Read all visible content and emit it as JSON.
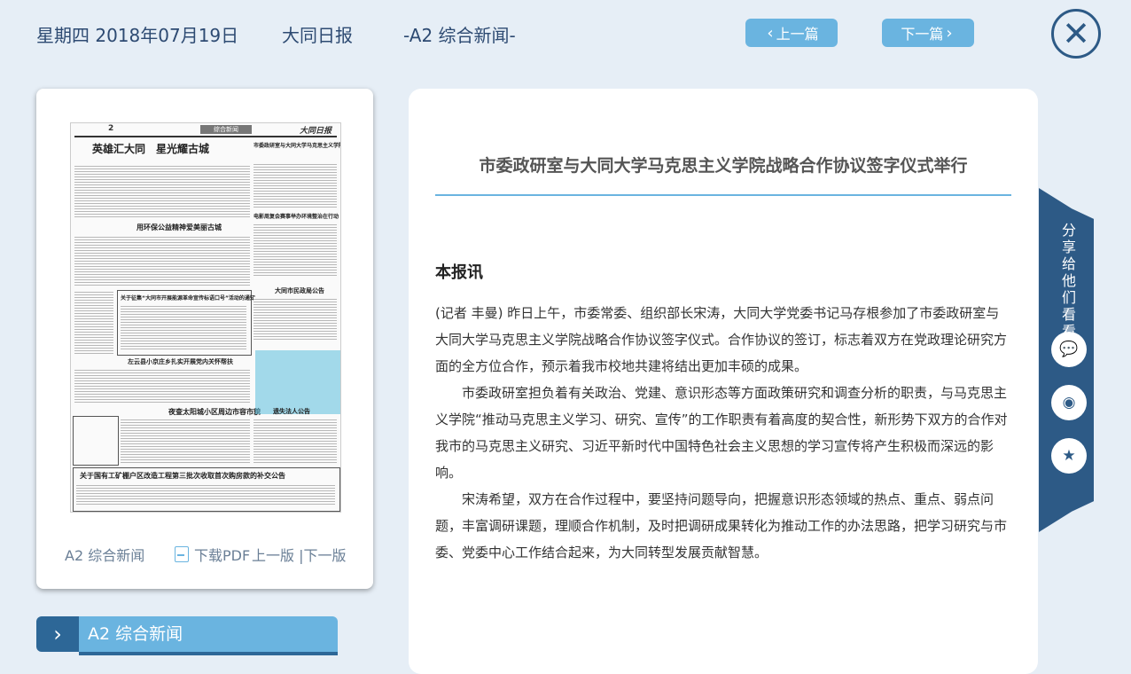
{
  "header": {
    "date": "星期四 2018年07月19日",
    "paper_name": "大同日报",
    "section": "-A2 综合新闻-",
    "prev_label": "上一篇",
    "next_label": "下一篇"
  },
  "thumbnail": {
    "page_no": "2",
    "band": "综合新闻",
    "masthead": "大同日报",
    "headlines": [
      "英雄汇大同　星光耀古城",
      "用环保公益精神爱美丽古城",
      "关于征集“大同市开展能源革命宣传标语口号”活动的通知",
      "左云县小京庄乡扎实开展党内关怀帮扶",
      "夜查太阳城小区周边市容市貌",
      "关于国有工矿棚户区改造工程第三批次收取首次购房款的补交公告",
      "市委政研室与大同大学马克思主义学院战略合作协议签字仪式举行",
      "电影周复会赛事举办环境整治在行动",
      "大同市民政局公告",
      "遗失法人公告"
    ],
    "caption": "A2 综合新闻",
    "pdf_label": "下载PDF",
    "prev_page": "上一版",
    "separator": " |",
    "next_page": "下一版"
  },
  "section_tab": {
    "arrow": "›",
    "label": "A2  综合新闻"
  },
  "article": {
    "title": "市委政研室与大同大学马克思主义学院战略合作协议签字仪式举行",
    "lead": "本报讯",
    "paragraphs": [
      "(记者 丰曼) 昨日上午，市委常委、组织部长宋涛，大同大学党委书记马存根参加了市委政研室与大同大学马克思主义学院战略合作协议签字仪式。合作协议的签订，标志着双方在党政理论研究方面的全方位合作，预示着我市校地共建将结出更加丰硕的成果。",
      "市委政研室担负着有关政治、党建、意识形态等方面政策研究和调查分析的职责，与马克思主义学院“推动马克思主义学习、研究、宣传”的工作职责有着高度的契合性，新形势下双方的合作对我市的马克思主义研究、习近平新时代中国特色社会主义思想的学习宣传将产生积极而深远的影响。",
      "宋涛希望，双方在合作过程中，要坚持问题导向，把握意识形态领域的热点、重点、弱点问题，丰富调研课题，理顺合作机制，及时把调研成果转化为推动工作的办法思路，把学习研究与市委、党委中心工作结合起来，为大同转型发展贡献智慧。"
    ]
  },
  "share": {
    "label": "分享给他们看看",
    "buttons": [
      "wechat-icon",
      "weibo-icon",
      "qzone-icon"
    ]
  },
  "colors": {
    "accent": "#6ab4e0",
    "dark": "#2d5a86",
    "background": "#e6eef6"
  }
}
